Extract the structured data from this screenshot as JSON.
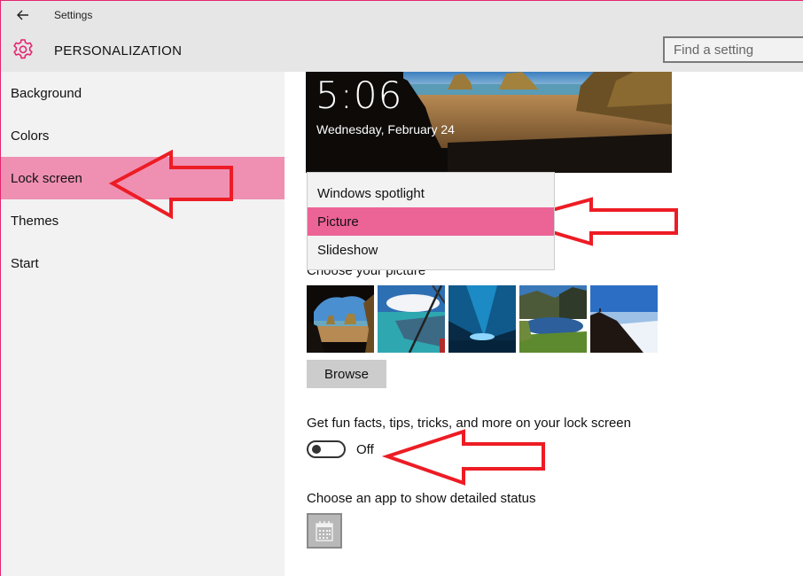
{
  "window": {
    "app_title": "Settings",
    "accent_color": "#e5246f"
  },
  "header": {
    "icon": "gear-icon",
    "title": "PERSONALIZATION",
    "search_placeholder": "Find a setting"
  },
  "sidebar": {
    "items": [
      {
        "label": "Background",
        "selected": false
      },
      {
        "label": "Colors",
        "selected": false
      },
      {
        "label": "Lock screen",
        "selected": true
      },
      {
        "label": "Themes",
        "selected": false
      },
      {
        "label": "Start",
        "selected": false
      }
    ],
    "selected_color": "#ef90b3"
  },
  "preview": {
    "time": "5:06",
    "date": "Wednesday, February 24"
  },
  "background_dropdown": {
    "options": [
      {
        "label": "Windows spotlight",
        "selected": false
      },
      {
        "label": "Picture",
        "selected": true
      },
      {
        "label": "Slideshow",
        "selected": false
      }
    ],
    "selected_color": "#ec6396"
  },
  "picture": {
    "label": "Choose your picture",
    "thumbnails": [
      {
        "name": "cave-beach"
      },
      {
        "name": "window-sea"
      },
      {
        "name": "ice-cave"
      },
      {
        "name": "mountain-lake"
      },
      {
        "name": "hill-clouds"
      }
    ],
    "browse_label": "Browse"
  },
  "fun_facts": {
    "label": "Get fun facts, tips, tricks, and more on your lock screen",
    "state": "Off",
    "enabled": false
  },
  "detailed_status": {
    "label": "Choose an app to show detailed status",
    "app_icon": "calendar-icon"
  },
  "annotations": {
    "arrow_color": "#ed1c24"
  }
}
